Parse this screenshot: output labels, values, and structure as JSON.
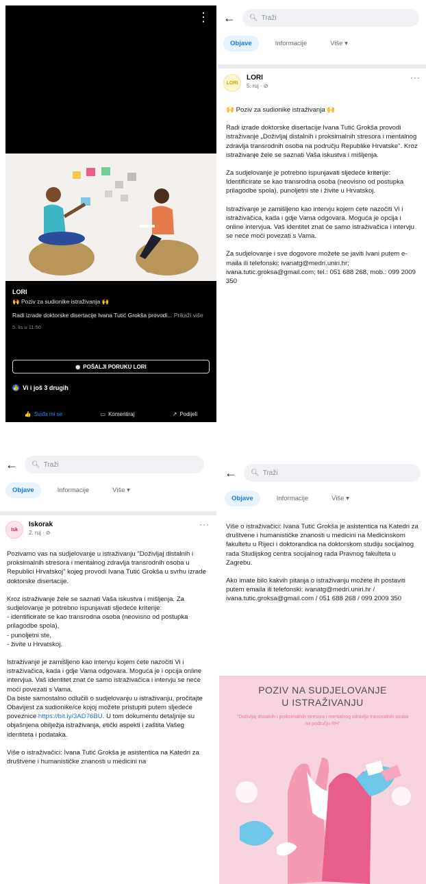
{
  "colors": {
    "fb_blue": "#1877f2",
    "link_blue": "#216fdb",
    "panel_dark": "#000000",
    "poster_pink": "#f7d3df"
  },
  "viewer": {
    "page_name": "LORI",
    "caption_title": "🙌 Poziv za sudionike istraživanja 🙌",
    "caption_body": "Radi izrade doktorske disertacije Ivana Tutić Grokša provodi...",
    "see_more": "Prikaži više",
    "timestamp": "5. lis u 11:50",
    "send_button": "POŠALJI PORUKU LORI",
    "reactions_text": "Vi i još 3 drugih",
    "actions": {
      "like": "Sviđa mi se",
      "comment": "Komentiraj",
      "share": "Podijeli"
    },
    "icons": {
      "more": "more-vertical-icon",
      "messenger": "messenger-icon",
      "like": "thumbs-up-icon",
      "comment": "comment-icon",
      "share": "share-icon"
    }
  },
  "page_common": {
    "search_placeholder": "Traži",
    "tabs": [
      "Objave",
      "Informacije",
      "Više ▾"
    ]
  },
  "post_lori": {
    "author": "LORI",
    "avatar_text": "LORI",
    "meta": "5. ruj · ⊘",
    "title": "🙌 Poziv za sudionike istraživanja 🙌",
    "paragraphs": [
      "Radi izrade doktorske disertacije Ivana Tutić Grokša provodi istraživanje „Doživljaj distalnih i proksimalnih stresora i mentalnog zdravlja transrodnih osoba na području Republike Hrvatske\". Kroz istraživanje žele se saznati Vaša iskustva i mišljenja.",
      "Za sudjelovanje je potrebno ispunjavati sljedeće kriterije: Identificirate se kao transrodna osoba (neovisno od postupka prilagodbe spola), punoljetni ste i živite u Hrvatskoj.",
      "Istraživanje je zamišljeno kao intervju kojem ćete nazočiti Vi i istraživačica, kada i gdje Vama odgovara. Moguća je opcija i online intervjua. Vaš identitet znat će samo istraživačica i intervju se neće moći povezati s Vama.",
      "Za sudjelovanje i sve dogovore možete se javiti Ivani putem e-maila ili telefonski: ivanatg@medri.uniri.hr; ivana.tutic.groksa@gmail.com; tel.: 051 688 268, mob.: 099 2009 350"
    ]
  },
  "post_iskorak": {
    "author": "Iskorak",
    "avatar_text": "Isk",
    "meta": "2. ruj · ⊘",
    "paragraphs": [
      "Pozivamo vas na sudjelovanje u istraživanju \"Doživljaj distalnih i proksimalnih stresora i mentalnog zdravlja transrodnih osoba u Republici Hrvatskoj\" kojeg provodi Ivana Tutić Grokša u svrhu izrade doktorske disertacije.",
      "Kroz istraživanje žele se saznati Vaša iskustva i mišljenja. Za sudjelovanje je potrebno ispunjavati sljedeće kriterije:\n- identificirate se kao transrodna osoba (neovisno od postupka prilagodbe spola),\n- punoljetni ste,\n- živite u Hrvatskoj.",
      "Istraživanje je zamišljeno kao intervju kojem ćete nazočiti Vi i istraživačica, kada i gdje Vama odgovara. Moguća je i opcija online intervjua. Vaš identitet znat će samo istraživačica i intervju se neće moći povezati s Vama.\nDa biste samostalno odlučili o sudjelovanju u istraživanju, pročitajte Obavijest za sudionike/ce kojoj možete pristupiti putem sljedeće poveznice",
      "Više o istraživačici: Ivana Tutić Grokša je asistentica na Katedri za društvene i humanističke znanosti u medicini na"
    ],
    "link_text": "https://bit.ly/3AD76BU",
    "after_link": ". U tom dokumentu detaljnije su objašnjena obilježja istraživanja, etički aspekti i zaštita Vašeg identiteta i podataka."
  },
  "post_more": {
    "paragraphs": [
      "Više o istraživačici: Ivana Tutić Grokša je asistentica na Katedri za društvene i humanističke znanosti u medicini na Medicinskom fakultetu u Rijeci i doktorandica na doktorskom studiju socijalnog rada Studijskog centra socijalnog rada Pravnog fakulteta u Zagrebu.",
      "Ako imate bilo kakvih pitanja o istraživanju možete ih postaviti putem emaila ili telefonski: ivanatg@medri.uniri.hr / ivana.tutic.groksa@gmail.com / 051 688 268 / 099 2009 350"
    ],
    "poster_title_1": "POZIV NA SUDJELOVANJE",
    "poster_title_2": "U ISTRAŽIVANJU",
    "poster_subtitle": "\"Doživljaj distalnih i proksimalnih stresora i mentalnog zdravlja transrodnih osoba na području RH\""
  }
}
